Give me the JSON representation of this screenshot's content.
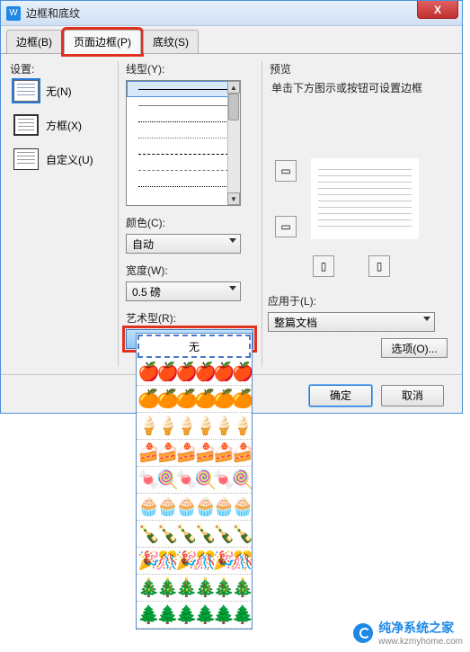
{
  "window": {
    "title": "边框和底纹",
    "app_glyph": "W"
  },
  "close": {
    "glyph": "X"
  },
  "tabs": [
    {
      "label": "边框(B)"
    },
    {
      "label": "页面边框(P)"
    },
    {
      "label": "底纹(S)"
    }
  ],
  "settings": {
    "label": "设置:",
    "items": [
      {
        "label": "无(N)"
      },
      {
        "label": "方框(X)"
      },
      {
        "label": "自定义(U)"
      }
    ]
  },
  "linestyle": {
    "label": "线型(Y):"
  },
  "color": {
    "label": "颜色(C):",
    "value": "自动"
  },
  "width": {
    "label": "宽度(W):",
    "value": "0.5 磅"
  },
  "art": {
    "label": "艺术型(R):",
    "value": "无"
  },
  "preview": {
    "label": "预览",
    "hint": "单击下方图示或按钮可设置边框"
  },
  "apply_to": {
    "label": "应用于(L):",
    "value": "整篇文档"
  },
  "options_btn": "选项(O)...",
  "ok_btn": "确定",
  "cancel_btn": "取消",
  "art_drop": {
    "none": "无",
    "rows": [
      "🍎🍎🍎🍎🍎🍎",
      "🍊🍊🍊🍊🍊🍊",
      "🍦🍦🍦🍦🍦🍦",
      "🍰🍰🍰🍰🍰🍰",
      "🍬🍭🍬🍭🍬🍭",
      "🧁🧁🧁🧁🧁🧁",
      "🍾🍾🍾🍾🍾🍾",
      "🎉🎊🎉🎊🎉🎊",
      "🎄🎄🎄🎄🎄🎄",
      "🌲🌲🌲🌲🌲🌲"
    ]
  },
  "watermark": {
    "line1": "纯净系统之家",
    "line2": "www.kzmyhome.com"
  }
}
